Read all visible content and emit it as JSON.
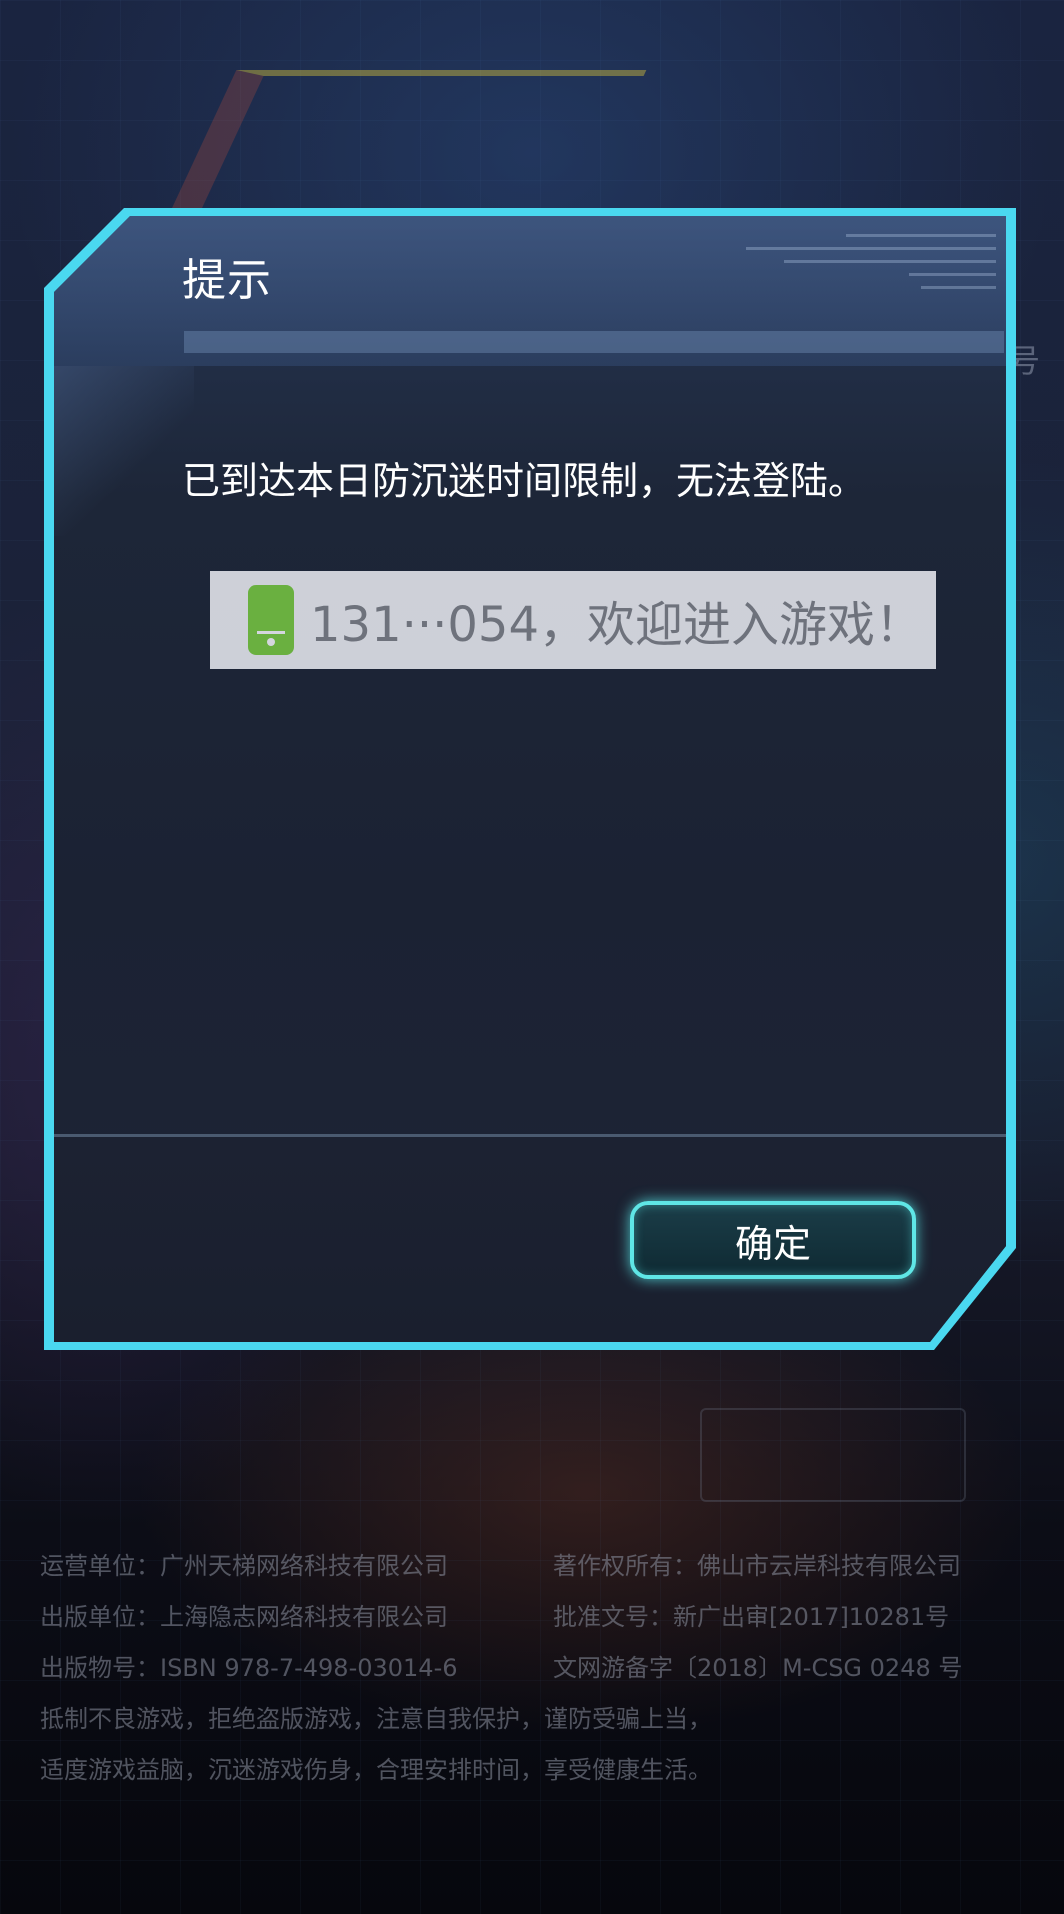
{
  "background": {
    "side_text": "账号"
  },
  "dialog": {
    "title": "提示",
    "message": "已到达本日防沉迷时间限制，无法登陆。",
    "confirm_label": "确定"
  },
  "toast": {
    "icon": "phone-icon",
    "text": "131···054，欢迎进入游戏！"
  },
  "legal": {
    "rows": [
      {
        "left": "运营单位：广州天梯网络科技有限公司",
        "right": "著作权所有：佛山市云岸科技有限公司"
      },
      {
        "left": "出版单位：上海隐志网络科技有限公司",
        "right": "批准文号：新广出审[2017]10281号"
      },
      {
        "left": "出版物号：ISBN 978-7-498-03014-6",
        "right": "文网游备字〔2018〕M-CSG 0248 号"
      }
    ],
    "lines": [
      "抵制不良游戏，拒绝盗版游戏，注意自我保护，谨防受骗上当，",
      "适度游戏益脑，沉迷游戏伤身，合理安排时间，享受健康生活。"
    ]
  },
  "colors": {
    "accent_glow": "#4ad8f0",
    "button_border": "#5fe6e6",
    "phone_icon": "#6ab040"
  }
}
